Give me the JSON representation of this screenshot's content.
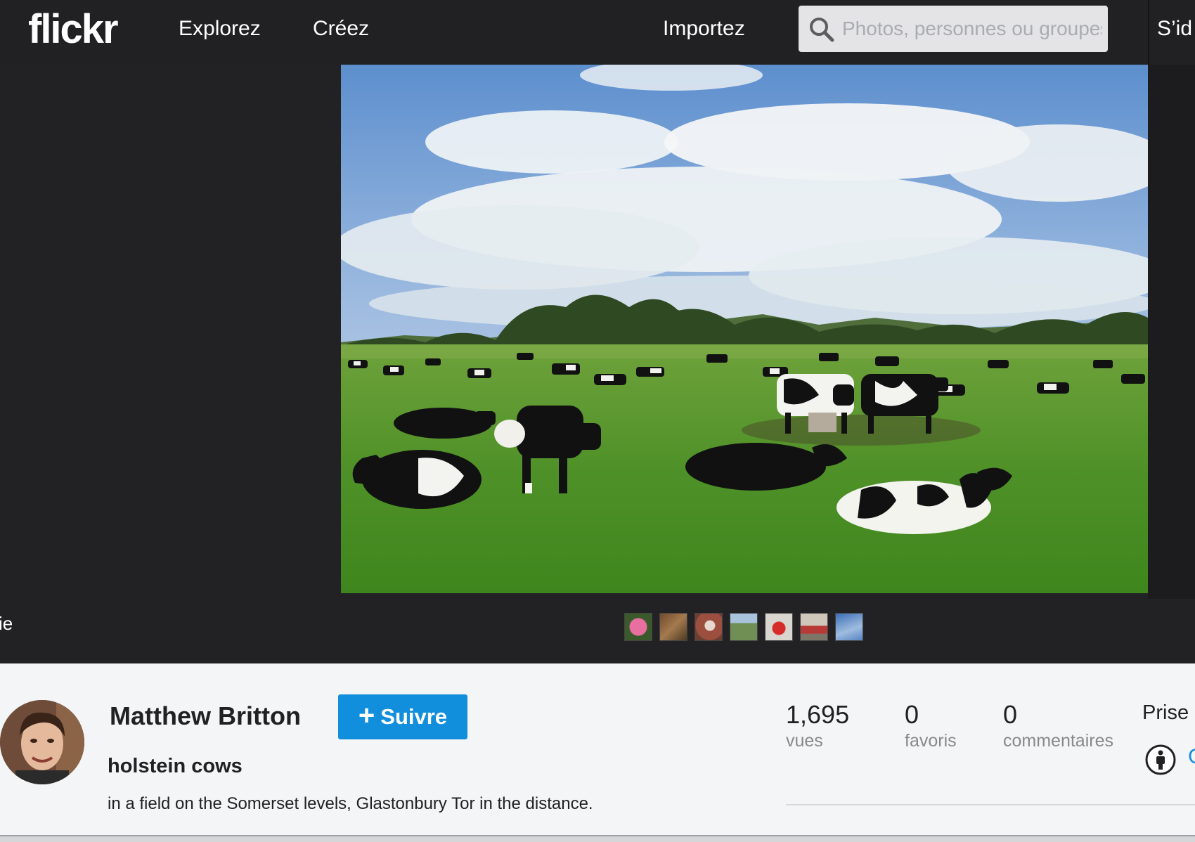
{
  "nav": {
    "logo": "flickr",
    "explore": "Explorez",
    "create": "Créez",
    "upload": "Importez",
    "signin": "S’id",
    "search_placeholder": "Photos, personnes ou groupes"
  },
  "stage": {
    "left_edge_text": "ie",
    "photo_subject": "holstein cows in a green field",
    "filmstrip": [
      {
        "icon": "pink-flower-thumb"
      },
      {
        "icon": "animal-thumb"
      },
      {
        "icon": "sign-thumb"
      },
      {
        "icon": "landscape-thumb"
      },
      {
        "icon": "red-object-thumb"
      },
      {
        "icon": "red-sign-thumb"
      },
      {
        "icon": "blue-sky-thumb"
      }
    ]
  },
  "owner": {
    "name": "Matthew Britton",
    "follow_label": "Suivre"
  },
  "photo": {
    "title": "holstein cows",
    "description": "in a field on the Somerset levels, Glastonbury Tor in the distance."
  },
  "stats": {
    "views": {
      "value": "1,695",
      "label": "vues"
    },
    "faves": {
      "value": "0",
      "label": "favoris"
    },
    "comments": {
      "value": "0",
      "label": "commentaires"
    }
  },
  "meta": {
    "taken_label": "Prise",
    "license_extra": "C"
  },
  "colors": {
    "nav_bg": "#212124",
    "stage_bg": "#222225",
    "accent_blue": "#128fdc",
    "panel_bg": "#f3f5f6"
  }
}
